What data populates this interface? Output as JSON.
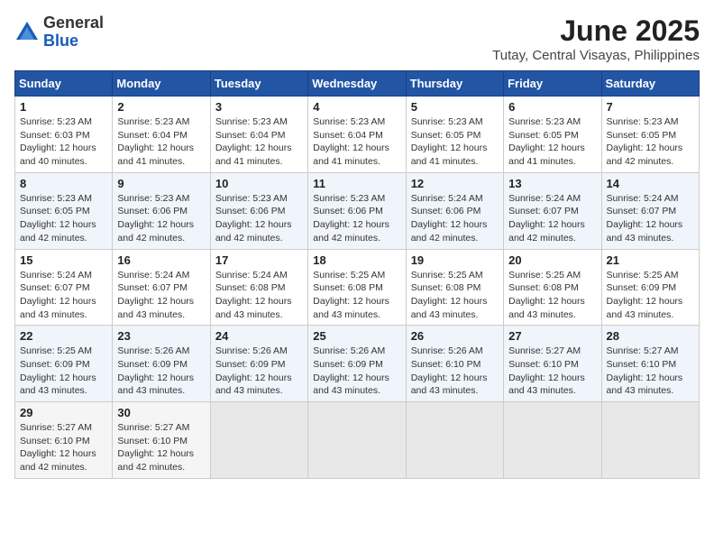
{
  "logo": {
    "general": "General",
    "blue": "Blue"
  },
  "title": "June 2025",
  "location": "Tutay, Central Visayas, Philippines",
  "weekdays": [
    "Sunday",
    "Monday",
    "Tuesday",
    "Wednesday",
    "Thursday",
    "Friday",
    "Saturday"
  ],
  "weeks": [
    [
      {
        "day": "1",
        "sunrise": "5:23 AM",
        "sunset": "6:03 PM",
        "daylight": "12 hours and 40 minutes."
      },
      {
        "day": "2",
        "sunrise": "5:23 AM",
        "sunset": "6:04 PM",
        "daylight": "12 hours and 41 minutes."
      },
      {
        "day": "3",
        "sunrise": "5:23 AM",
        "sunset": "6:04 PM",
        "daylight": "12 hours and 41 minutes."
      },
      {
        "day": "4",
        "sunrise": "5:23 AM",
        "sunset": "6:04 PM",
        "daylight": "12 hours and 41 minutes."
      },
      {
        "day": "5",
        "sunrise": "5:23 AM",
        "sunset": "6:05 PM",
        "daylight": "12 hours and 41 minutes."
      },
      {
        "day": "6",
        "sunrise": "5:23 AM",
        "sunset": "6:05 PM",
        "daylight": "12 hours and 41 minutes."
      },
      {
        "day": "7",
        "sunrise": "5:23 AM",
        "sunset": "6:05 PM",
        "daylight": "12 hours and 42 minutes."
      }
    ],
    [
      {
        "day": "8",
        "sunrise": "5:23 AM",
        "sunset": "6:05 PM",
        "daylight": "12 hours and 42 minutes."
      },
      {
        "day": "9",
        "sunrise": "5:23 AM",
        "sunset": "6:06 PM",
        "daylight": "12 hours and 42 minutes."
      },
      {
        "day": "10",
        "sunrise": "5:23 AM",
        "sunset": "6:06 PM",
        "daylight": "12 hours and 42 minutes."
      },
      {
        "day": "11",
        "sunrise": "5:23 AM",
        "sunset": "6:06 PM",
        "daylight": "12 hours and 42 minutes."
      },
      {
        "day": "12",
        "sunrise": "5:24 AM",
        "sunset": "6:06 PM",
        "daylight": "12 hours and 42 minutes."
      },
      {
        "day": "13",
        "sunrise": "5:24 AM",
        "sunset": "6:07 PM",
        "daylight": "12 hours and 42 minutes."
      },
      {
        "day": "14",
        "sunrise": "5:24 AM",
        "sunset": "6:07 PM",
        "daylight": "12 hours and 43 minutes."
      }
    ],
    [
      {
        "day": "15",
        "sunrise": "5:24 AM",
        "sunset": "6:07 PM",
        "daylight": "12 hours and 43 minutes."
      },
      {
        "day": "16",
        "sunrise": "5:24 AM",
        "sunset": "6:07 PM",
        "daylight": "12 hours and 43 minutes."
      },
      {
        "day": "17",
        "sunrise": "5:24 AM",
        "sunset": "6:08 PM",
        "daylight": "12 hours and 43 minutes."
      },
      {
        "day": "18",
        "sunrise": "5:25 AM",
        "sunset": "6:08 PM",
        "daylight": "12 hours and 43 minutes."
      },
      {
        "day": "19",
        "sunrise": "5:25 AM",
        "sunset": "6:08 PM",
        "daylight": "12 hours and 43 minutes."
      },
      {
        "day": "20",
        "sunrise": "5:25 AM",
        "sunset": "6:08 PM",
        "daylight": "12 hours and 43 minutes."
      },
      {
        "day": "21",
        "sunrise": "5:25 AM",
        "sunset": "6:09 PM",
        "daylight": "12 hours and 43 minutes."
      }
    ],
    [
      {
        "day": "22",
        "sunrise": "5:25 AM",
        "sunset": "6:09 PM",
        "daylight": "12 hours and 43 minutes."
      },
      {
        "day": "23",
        "sunrise": "5:26 AM",
        "sunset": "6:09 PM",
        "daylight": "12 hours and 43 minutes."
      },
      {
        "day": "24",
        "sunrise": "5:26 AM",
        "sunset": "6:09 PM",
        "daylight": "12 hours and 43 minutes."
      },
      {
        "day": "25",
        "sunrise": "5:26 AM",
        "sunset": "6:09 PM",
        "daylight": "12 hours and 43 minutes."
      },
      {
        "day": "26",
        "sunrise": "5:26 AM",
        "sunset": "6:10 PM",
        "daylight": "12 hours and 43 minutes."
      },
      {
        "day": "27",
        "sunrise": "5:27 AM",
        "sunset": "6:10 PM",
        "daylight": "12 hours and 43 minutes."
      },
      {
        "day": "28",
        "sunrise": "5:27 AM",
        "sunset": "6:10 PM",
        "daylight": "12 hours and 43 minutes."
      }
    ],
    [
      {
        "day": "29",
        "sunrise": "5:27 AM",
        "sunset": "6:10 PM",
        "daylight": "12 hours and 42 minutes."
      },
      {
        "day": "30",
        "sunrise": "5:27 AM",
        "sunset": "6:10 PM",
        "daylight": "12 hours and 42 minutes."
      },
      null,
      null,
      null,
      null,
      null
    ]
  ],
  "labels": {
    "sunrise": "Sunrise:",
    "sunset": "Sunset:",
    "daylight": "Daylight:"
  }
}
